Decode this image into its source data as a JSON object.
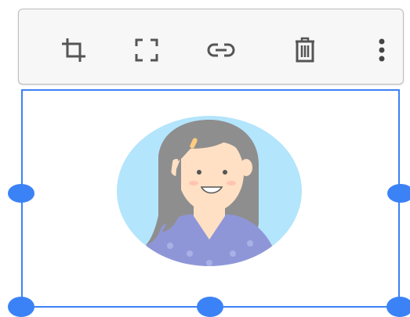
{
  "toolbar": {
    "items": [
      {
        "icon": "crop-icon",
        "action": "crop"
      },
      {
        "icon": "expand-icon",
        "action": "expand"
      },
      {
        "icon": "link-icon",
        "action": "link"
      },
      {
        "icon": "trash-icon",
        "action": "delete"
      },
      {
        "icon": "more-vertical-icon",
        "action": "more"
      }
    ],
    "icon_color": "#555555"
  },
  "image": {
    "content": "avatar-girl-illustration",
    "background_color": "#b3e5fc",
    "hair_color": "#8e8e8e",
    "skin_color": "#ffe0c4",
    "shirt_color": "#8f96d8"
  },
  "selection": {
    "accent": "#3b82f6",
    "handles": [
      "left-mid",
      "right-mid",
      "bottom-left",
      "bottom-mid",
      "bottom-right"
    ]
  }
}
